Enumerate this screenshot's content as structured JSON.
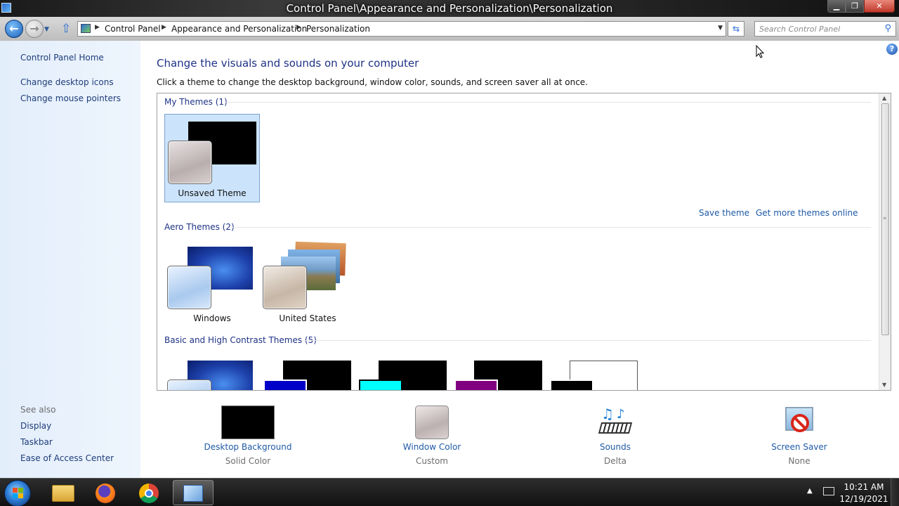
{
  "window": {
    "title": "Control Panel\\Appearance and Personalization\\Personalization",
    "buttons": {
      "minimize": "▁",
      "maximize": "❐",
      "close": "✕"
    }
  },
  "addressbar": {
    "breadcrumbs": [
      "Control Panel",
      "Appearance and Personalization",
      "Personalization"
    ],
    "search_placeholder": "Search Control Panel"
  },
  "sidebar": {
    "home": "Control Panel Home",
    "tasks": [
      "Change desktop icons",
      "Change mouse pointers"
    ],
    "see_also_label": "See also",
    "see_also": [
      "Display",
      "Taskbar",
      "Ease of Access Center"
    ]
  },
  "main": {
    "heading": "Change the visuals and sounds on your computer",
    "subtitle": "Click a theme to change the desktop background, window color, sounds, and screen saver all at once.",
    "groups": {
      "my_themes": "My Themes (1)",
      "aero_themes": "Aero Themes (2)",
      "basic_themes": "Basic and High Contrast Themes (5)"
    },
    "themes": {
      "unsaved": "Unsaved Theme",
      "windows": "Windows",
      "united_states": "United States"
    },
    "links": {
      "save_theme": "Save theme",
      "more_themes": "Get more themes online"
    }
  },
  "bottom": {
    "desktop_background": {
      "label": "Desktop Background",
      "value": "Solid Color"
    },
    "window_color": {
      "label": "Window Color",
      "value": "Custom"
    },
    "sounds": {
      "label": "Sounds",
      "value": "Delta"
    },
    "screen_saver": {
      "label": "Screen Saver",
      "value": "None"
    }
  },
  "taskbar": {
    "time": "10:21 AM",
    "date": "12/19/2021"
  },
  "colors": {
    "link": "#1e5aa6",
    "heading": "#1e3287",
    "selection": "#cce4fb"
  }
}
